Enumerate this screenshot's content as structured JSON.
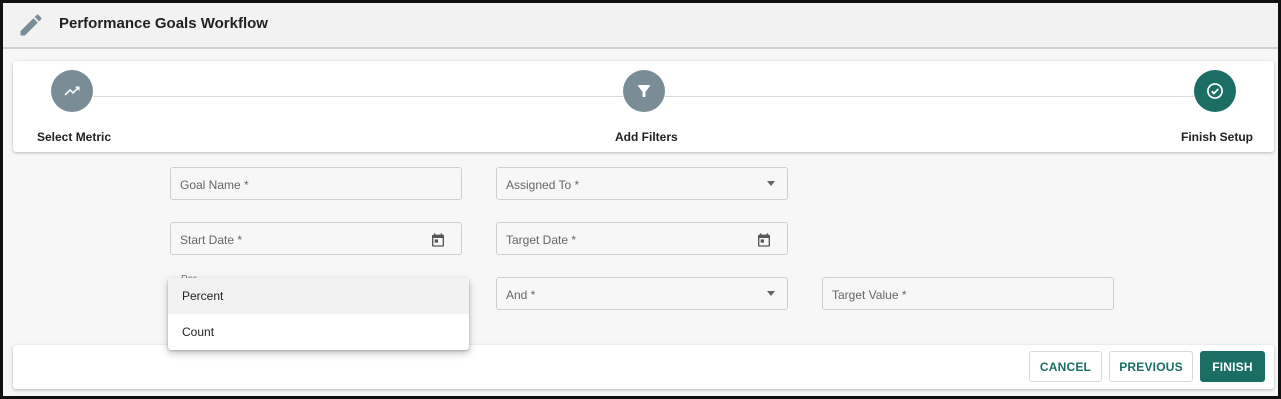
{
  "header": {
    "title": "Performance Goals Workflow",
    "icon": "pencil-icon"
  },
  "stepper": {
    "steps": [
      {
        "label": "Select Metric",
        "icon": "trending-up-icon",
        "color": "#7a8c96"
      },
      {
        "label": "Add Filters",
        "icon": "filter-icon",
        "color": "#7a8c96"
      },
      {
        "label": "Finish Setup",
        "icon": "check-circle-icon",
        "color": "#1b6e64"
      }
    ]
  },
  "form": {
    "goal_name": {
      "placeholder": "Goal Name *",
      "value": ""
    },
    "assigned_to": {
      "placeholder": "Assigned To *",
      "value": ""
    },
    "start_date": {
      "placeholder": "Start Date *",
      "value": ""
    },
    "target_date": {
      "placeholder": "Target Date *",
      "value": ""
    },
    "and_field": {
      "placeholder": "And *",
      "value": ""
    },
    "target_value": {
      "placeholder": "Target Value *",
      "value": ""
    },
    "hidden_select_label": "Per..."
  },
  "dropdown": {
    "options": [
      "Percent",
      "Count"
    ]
  },
  "footer": {
    "cancel_label": "CANCEL",
    "previous_label": "PREVIOUS",
    "finish_label": "FINISH"
  },
  "colors": {
    "accent": "#1b6e64",
    "step_inactive": "#7a8c96"
  }
}
